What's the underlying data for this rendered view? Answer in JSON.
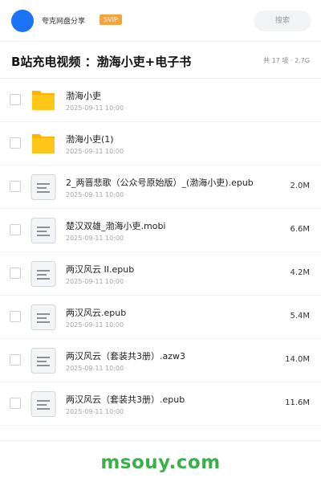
{
  "header": {
    "username": "夸克网盘分享",
    "badge": "SVIP",
    "search_placeholder": "搜索"
  },
  "folder": {
    "title": "B站充电视频 ：渤海小吏+电子书",
    "summary": "共 17 项 · 2.7G"
  },
  "files": [
    {
      "name": "渤海小吏",
      "date": "2025-09-11 10:00",
      "size": "",
      "icon": "folder-icon"
    },
    {
      "name": "渤海小吏(1)",
      "date": "2025-09-11 10:00",
      "size": "",
      "icon": "folder-icon"
    },
    {
      "name": "2_两晋悲歌（公众号原始版）_(渤海小吏).epub",
      "date": "2025-09-11 10:00",
      "size": "2.0M",
      "icon": "document-icon"
    },
    {
      "name": "楚汉双雄_渤海小吏.mobi",
      "date": "2025-09-11 10:00",
      "size": "6.6M",
      "icon": "document-icon"
    },
    {
      "name": "两汉风云 II.epub",
      "date": "2025-09-11 10:00",
      "size": "4.2M",
      "icon": "document-icon"
    },
    {
      "name": "两汉风云.epub",
      "date": "2025-09-11 10:00",
      "size": "5.4M",
      "icon": "document-icon"
    },
    {
      "name": "两汉风云（套装共3册）.azw3",
      "date": "2025-09-11 10:00",
      "size": "14.0M",
      "icon": "document-icon"
    },
    {
      "name": "两汉风云（套装共3册）.epub",
      "date": "2025-09-11 10:00",
      "size": "11.6M",
      "icon": "document-icon"
    }
  ],
  "watermark": "msouy.com",
  "colors": {
    "accent": "#1a73f5",
    "svip": "#f7a23a",
    "folder": "#ffc61a",
    "watermark": "#3ab04a"
  }
}
